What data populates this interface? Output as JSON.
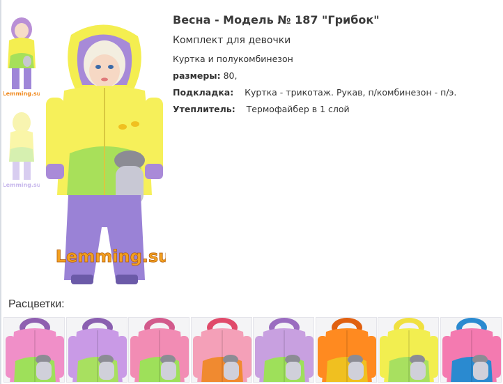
{
  "product": {
    "title": "Весна - Модель № 187 \"Грибок\"",
    "subtitle": "Комплект для девочки",
    "composition": "Куртка и полукомбинезон",
    "sizes_label": "размеры:",
    "sizes_value": "80,",
    "lining_label": "Подкладка:",
    "lining_value": "Куртка - трикотаж. Рукав, п/комбинезон - п/э.",
    "insulation_label": "Утеплитель:",
    "insulation_value": "Термофайбер в 1 слой"
  },
  "brand": {
    "logo_text": "Lemming.su"
  },
  "colors_heading": "Расцветки:",
  "swatches": [
    {
      "jacket": "#f08fc8",
      "hood": "#8f5fb0",
      "accent": "#9ee05a"
    },
    {
      "jacket": "#c99ae6",
      "hood": "#8a5fb0",
      "accent": "#a8e060"
    },
    {
      "jacket": "#f28cb4",
      "hood": "#d25a8c",
      "accent": "#9ee05a"
    },
    {
      "jacket": "#f4a0b8",
      "hood": "#e04a6a",
      "accent": "#f08a30"
    },
    {
      "jacket": "#c8a0e0",
      "hood": "#9a6cc0",
      "accent": "#9ee05a"
    },
    {
      "jacket": "#ff8a20",
      "hood": "#e06010",
      "accent": "#f0c020"
    },
    {
      "jacket": "#f2ee50",
      "hood": "#f0e040",
      "accent": "#a8e060"
    },
    {
      "jacket": "#f47ab0",
      "hood": "#2a8ad0",
      "accent": "#2a8ad0"
    }
  ]
}
